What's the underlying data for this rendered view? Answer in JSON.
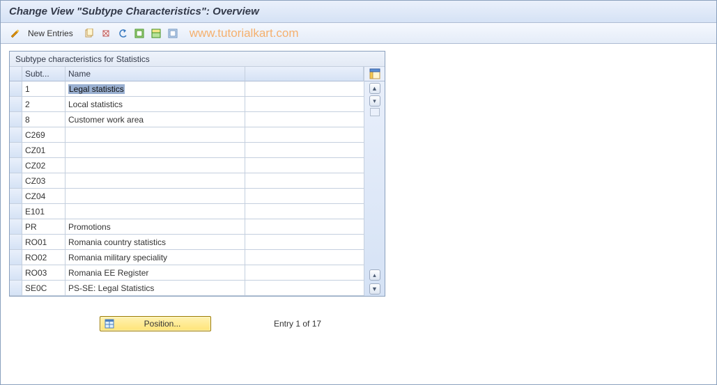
{
  "titlebar": {
    "title": "Change View \"Subtype Characteristics\": Overview"
  },
  "toolbar": {
    "new_entries_label": "New Entries",
    "watermark": "www.tutorialkart.com"
  },
  "panel": {
    "title": "Subtype characteristics for Statistics",
    "columns": {
      "subtype": "Subt...",
      "name": "Name"
    }
  },
  "rows": [
    {
      "subtype": "1",
      "name": "Legal statistics",
      "selected": true
    },
    {
      "subtype": "2",
      "name": "Local statistics"
    },
    {
      "subtype": "8",
      "name": "Customer work area"
    },
    {
      "subtype": "C269",
      "name": ""
    },
    {
      "subtype": "CZ01",
      "name": ""
    },
    {
      "subtype": "CZ02",
      "name": ""
    },
    {
      "subtype": "CZ03",
      "name": ""
    },
    {
      "subtype": "CZ04",
      "name": ""
    },
    {
      "subtype": "E101",
      "name": ""
    },
    {
      "subtype": "PR",
      "name": "Promotions"
    },
    {
      "subtype": "RO01",
      "name": "Romania country statistics"
    },
    {
      "subtype": "RO02",
      "name": "Romania military speciality"
    },
    {
      "subtype": "RO03",
      "name": "Romania EE Register"
    },
    {
      "subtype": "SE0C",
      "name": "PS-SE: Legal Statistics"
    }
  ],
  "footer": {
    "position_label": "Position...",
    "entry_text": "Entry 1 of 17"
  }
}
